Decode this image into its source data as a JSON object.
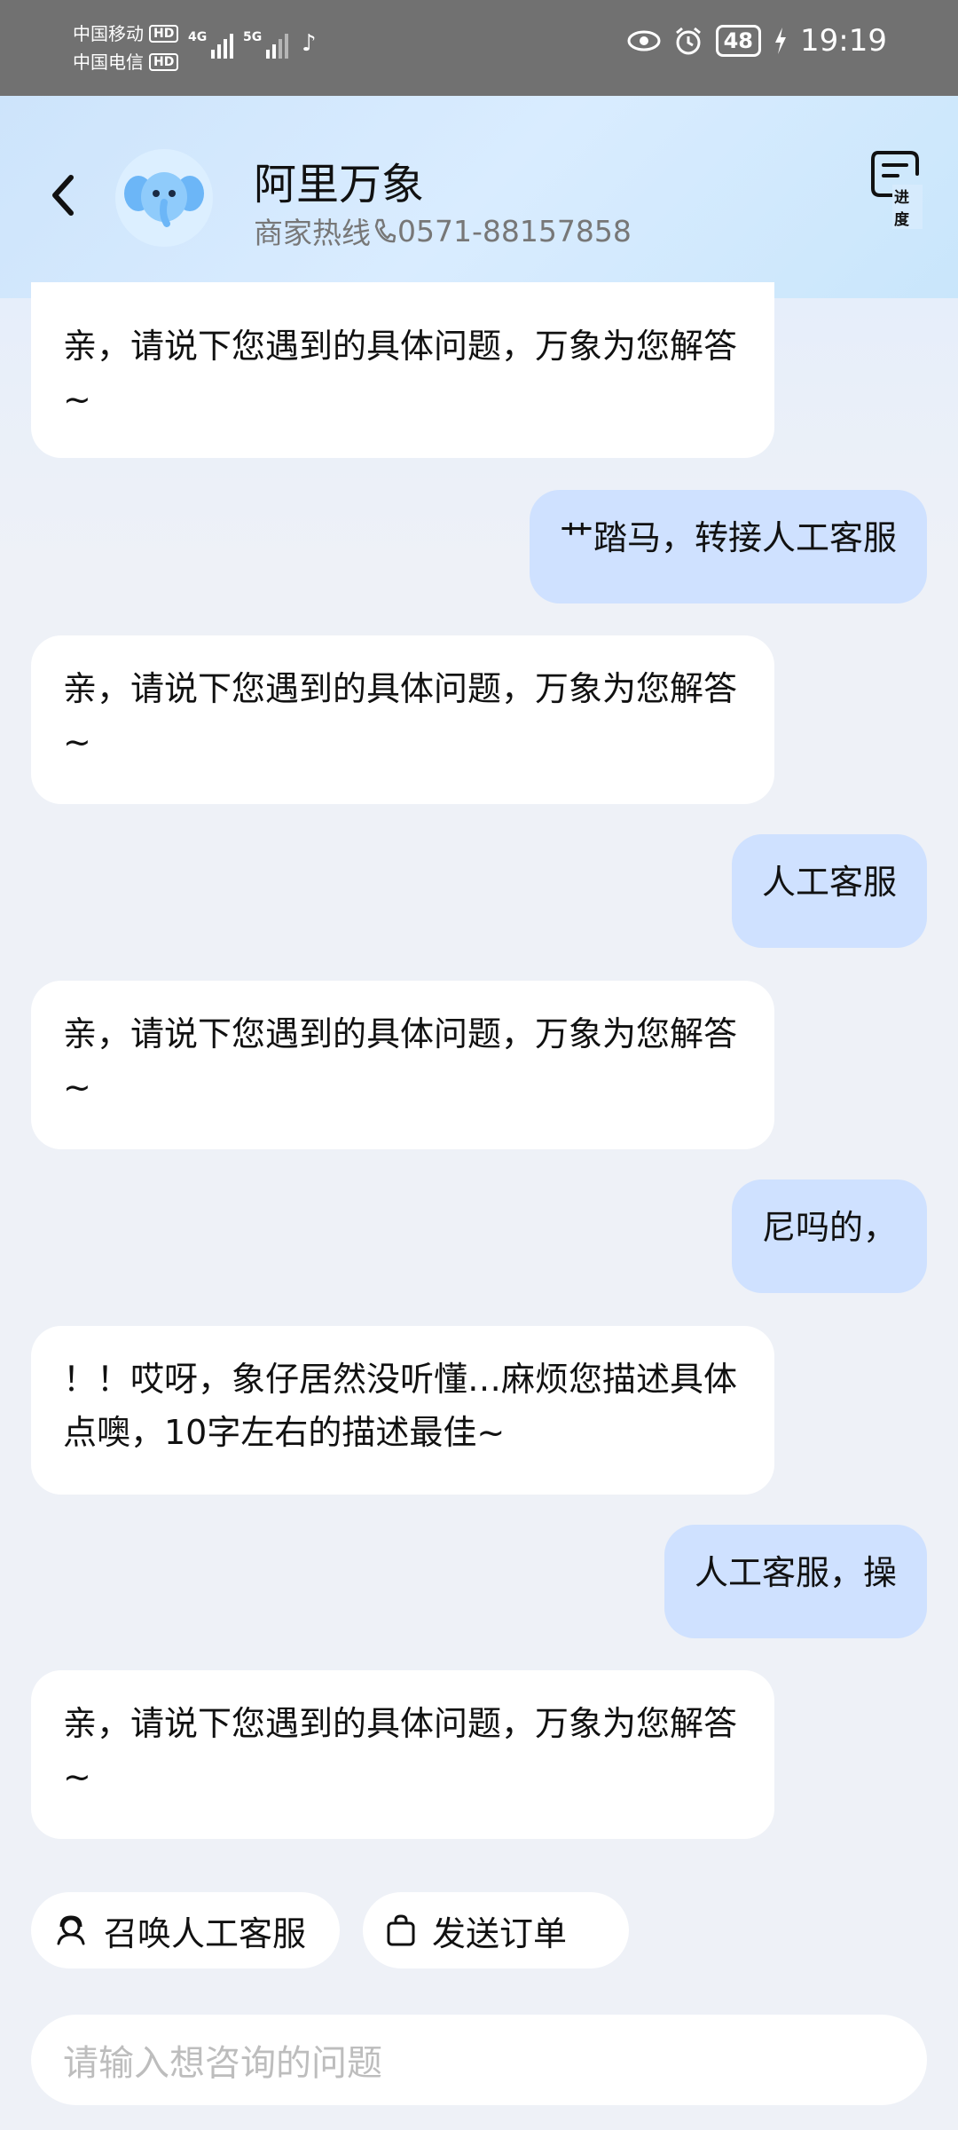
{
  "status_bar": {
    "carrier1": "中国移动",
    "carrier2": "中国电信",
    "hd": "HD",
    "net1": "4G",
    "net2": "5G",
    "battery": "48",
    "time": "19:19"
  },
  "header": {
    "title": "阿里万象",
    "hotline_label": "商家热线",
    "hotline_number": "0571-88157858",
    "progress_label": "进度"
  },
  "messages": [
    {
      "from": "bot",
      "text": "亲，请说下您遇到的具体问题，万象为您解答~"
    },
    {
      "from": "me",
      "text": "艹踏马，转接人工客服"
    },
    {
      "from": "bot",
      "text": "亲，请说下您遇到的具体问题，万象为您解答~"
    },
    {
      "from": "me",
      "text": "人工客服"
    },
    {
      "from": "bot",
      "text": "亲，请说下您遇到的具体问题，万象为您解答~"
    },
    {
      "from": "me",
      "text": "尼吗的，"
    },
    {
      "from": "bot",
      "text": "！！哎呀，象仔居然没听懂…麻烦您描述具体点噢，10字左右的描述最佳~"
    },
    {
      "from": "me",
      "text": "人工客服，操"
    },
    {
      "from": "bot",
      "text": "亲，请说下您遇到的具体问题，万象为您解答~"
    }
  ],
  "quick_actions": {
    "call_human": "召唤人工客服",
    "send_order": "发送订单"
  },
  "input": {
    "placeholder": "请输入想咨询的问题"
  },
  "colors": {
    "user_bubble": "#cfe1ff",
    "bot_bubble": "#ffffff",
    "accent": "#3a8ef6"
  }
}
